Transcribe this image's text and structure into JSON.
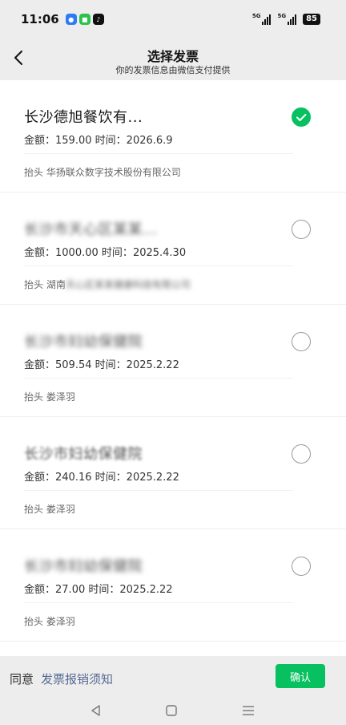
{
  "status_bar": {
    "time": "11:06",
    "battery": "85",
    "network_1": "5G",
    "network_2": "5G"
  },
  "nav": {
    "title": "选择发票",
    "subtitle": "你的发票信息由微信支付提供"
  },
  "invoices": [
    {
      "name": "长沙德旭餐饮有...",
      "amount_label": "金额：",
      "amount": "159.00",
      "time_label": "时间：",
      "time": "2026.6.9",
      "header_label": "抬头",
      "header": "华扬联众数字技术股份有限公司",
      "checked": true
    },
    {
      "name": "长沙市天心区某某...",
      "amount_label": "金额：",
      "amount": "1000.00",
      "time_label": "时间：",
      "time": "2025.4.30",
      "header_label": "抬头",
      "header_visible": "湖南",
      "header": "天心区某某健康科技有限公司",
      "checked": false
    },
    {
      "name": "长沙市妇幼保健院",
      "amount_label": "金额：",
      "amount": "509.54",
      "time_label": "时间：",
      "time": "2025.2.22",
      "header_label": "抬头",
      "header": "娄泽羽",
      "checked": false
    },
    {
      "name": "长沙市妇幼保健院",
      "amount_label": "金额：",
      "amount": "240.16",
      "time_label": "时间：",
      "time": "2025.2.22",
      "header_label": "抬头",
      "header": "娄泽羽",
      "checked": false
    },
    {
      "name": "长沙市妇幼保健院",
      "amount_label": "金额：",
      "amount": "27.00",
      "time_label": "时间：",
      "time": "2025.2.22",
      "header_label": "抬头",
      "header": "娄泽羽",
      "checked": false
    }
  ],
  "action_bar": {
    "agree_label": "同意",
    "notice_link": "发票报销须知",
    "confirm_label": "确认"
  },
  "colors": {
    "accent_green": "#07c160",
    "link_blue": "#576b95",
    "background": "#ededed"
  },
  "icons": {
    "back": "chevron-left-icon",
    "check": "check-icon",
    "sys_back": "triangle-back-icon",
    "sys_home": "square-home-icon",
    "sys_menu": "three-lines-menu-icon"
  }
}
